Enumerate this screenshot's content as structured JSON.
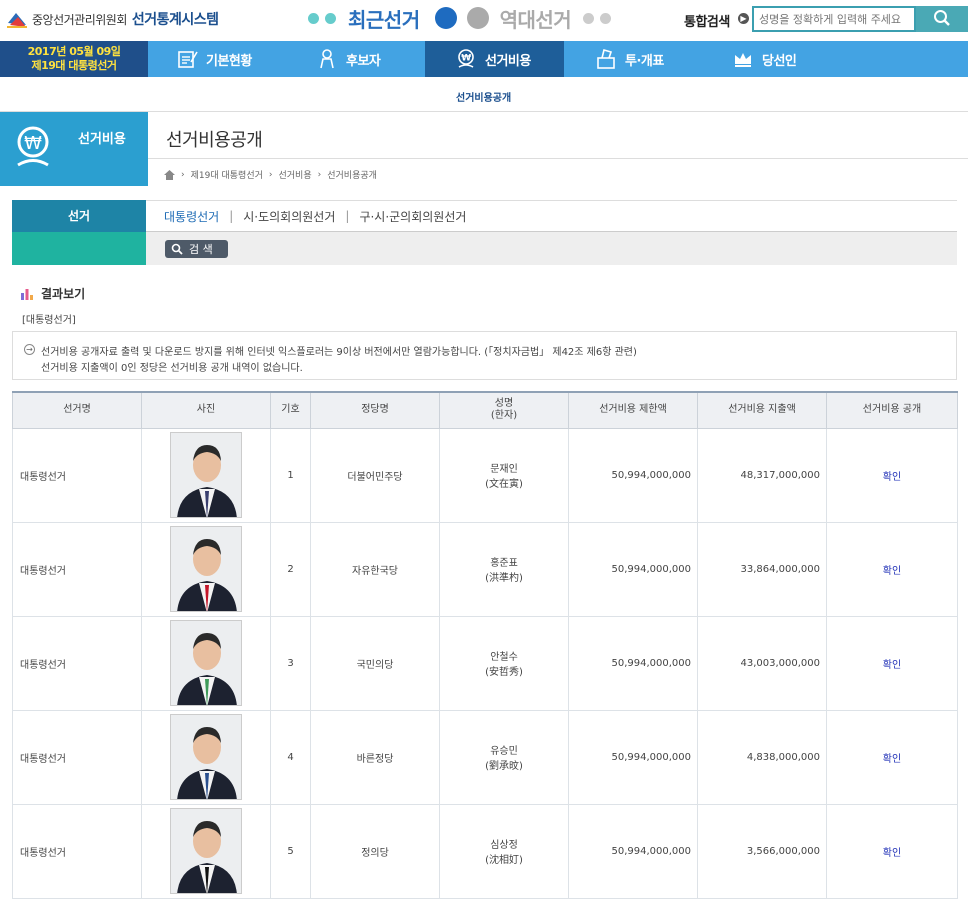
{
  "header": {
    "org_name": "중앙선거관리위원회",
    "system_name": "선거통계시스템",
    "recent_label": "최근선거",
    "past_label": "역대선거",
    "search_label": "통합검색",
    "search_placeholder": "성명을 정확하게 입력해 주세요"
  },
  "nav": {
    "date": "2017년 05월 09일",
    "election": "제19대 대통령선거",
    "items": [
      {
        "label": "기본현황",
        "icon": "clipboard-icon"
      },
      {
        "label": "후보자",
        "icon": "person-icon"
      },
      {
        "label": "선거비용",
        "icon": "won-coin-icon",
        "active": true
      },
      {
        "label": "투·개표",
        "icon": "ballot-box-icon"
      },
      {
        "label": "당선인",
        "icon": "crown-icon"
      }
    ]
  },
  "subnav": {
    "link": "선거비용공개"
  },
  "section": {
    "badge": "선거비용",
    "title": "선거비용공개",
    "breadcrumb": [
      "제19대 대통령선거",
      "선거비용",
      "선거비용공개"
    ]
  },
  "filter": {
    "label": "선거",
    "tabs": [
      "대통령선거",
      "시·도의회의원선거",
      "구·시·군의회의원선거"
    ],
    "search_button": "검 색"
  },
  "result": {
    "heading": "결과보기",
    "subheading": "[대통령선거]",
    "notice_line1": "선거비용 공개자료 출력 및 다운로드 방지를 위해 인터넷 익스플로러는 9이상 버전에서만 열람가능합니다. (「정치자금법」 제42조 제6항 관련)",
    "notice_line2": "선거비용 지출액이 0인 정당은 선거비용 공개 내역이 없습니다."
  },
  "table": {
    "headers": {
      "election": "선거명",
      "photo": "사진",
      "number": "기호",
      "party": "정당명",
      "name": "성명",
      "name_sub": "(한자)",
      "limit": "선거비용 제한액",
      "spent": "선거비용 지출액",
      "disclosure": "선거비용 공개"
    },
    "rows": [
      {
        "election": "대통령선거",
        "number": "1",
        "party": "더불어민주당",
        "name": "문재인",
        "hanja": "(文在寅)",
        "limit": "50,994,000,000",
        "spent": "48,317,000,000",
        "link": "확인",
        "tie": "#3a3f6e"
      },
      {
        "election": "대통령선거",
        "number": "2",
        "party": "자유한국당",
        "name": "홍준표",
        "hanja": "(洪準杓)",
        "limit": "50,994,000,000",
        "spent": "33,864,000,000",
        "link": "확인",
        "tie": "#c4162a"
      },
      {
        "election": "대통령선거",
        "number": "3",
        "party": "국민의당",
        "name": "안철수",
        "hanja": "(安哲秀)",
        "limit": "50,994,000,000",
        "spent": "43,003,000,000",
        "link": "확인",
        "tie": "#3f9b5a"
      },
      {
        "election": "대통령선거",
        "number": "4",
        "party": "바른정당",
        "name": "유승민",
        "hanja": "(劉承旼)",
        "limit": "50,994,000,000",
        "spent": "4,838,000,000",
        "link": "확인",
        "tie": "#2a4f8e"
      },
      {
        "election": "대통령선거",
        "number": "5",
        "party": "정의당",
        "name": "심상정",
        "hanja": "(沈相奵)",
        "limit": "50,994,000,000",
        "spent": "3,566,000,000",
        "link": "확인",
        "tie": "#111111"
      }
    ]
  }
}
